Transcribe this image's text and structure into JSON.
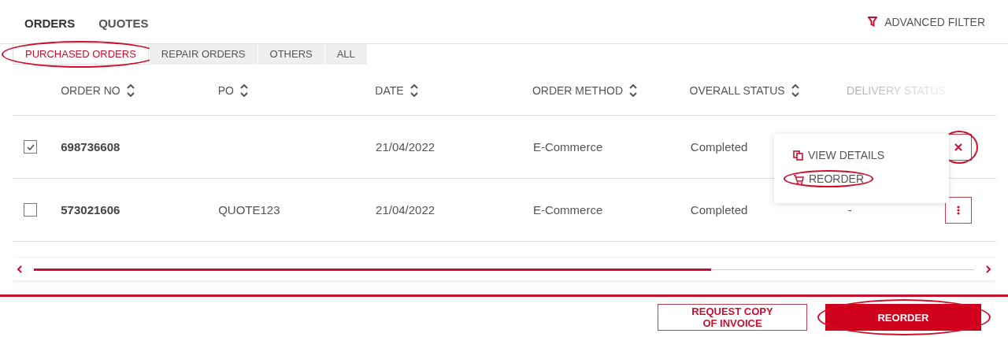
{
  "nav_tabs": [
    {
      "label": "ORDERS",
      "selected": true
    },
    {
      "label": "QUOTES",
      "selected": false
    }
  ],
  "advanced_filter": {
    "label": "ADVANCED FILTER"
  },
  "order_tabs": [
    {
      "label": "PURCHASED ORDERS",
      "selected": true,
      "highlighted": true
    },
    {
      "label": "REPAIR ORDERS",
      "selected": false,
      "highlighted": false
    },
    {
      "label": "OTHERS",
      "selected": false,
      "highlighted": false
    },
    {
      "label": "ALL",
      "selected": false,
      "highlighted": false
    }
  ],
  "table": {
    "columns": [
      {
        "label": "ORDER NO",
        "sortable": true
      },
      {
        "label": "PO",
        "sortable": true
      },
      {
        "label": "DATE",
        "sortable": true
      },
      {
        "label": "ORDER METHOD",
        "sortable": true
      },
      {
        "label": "OVERALL STATUS",
        "sortable": true
      },
      {
        "label": "DELIVERY STATUS",
        "sortable": false
      }
    ],
    "rows": [
      {
        "checked": true,
        "menu_open": true,
        "highlighted": true,
        "cells": [
          "698736608",
          "",
          "21/04/2022",
          "E-Commerce",
          "Completed",
          ""
        ]
      },
      {
        "checked": false,
        "menu_open": false,
        "highlighted": false,
        "cells": [
          "573021606",
          "QUOTE123",
          "21/04/2022",
          "E-Commerce",
          "Completed",
          "-"
        ]
      }
    ]
  },
  "row_menu": {
    "items": [
      {
        "label": "VIEW DETAILS",
        "kind": "details",
        "highlighted": false
      },
      {
        "label": "REORDER",
        "kind": "cart",
        "highlighted": true
      }
    ]
  },
  "footer_buttons": [
    {
      "label": "REQUEST COPY OF INVOICE",
      "kind": "outline",
      "highlighted": false
    },
    {
      "label": "REORDER",
      "kind": "primary",
      "highlighted": true
    }
  ]
}
